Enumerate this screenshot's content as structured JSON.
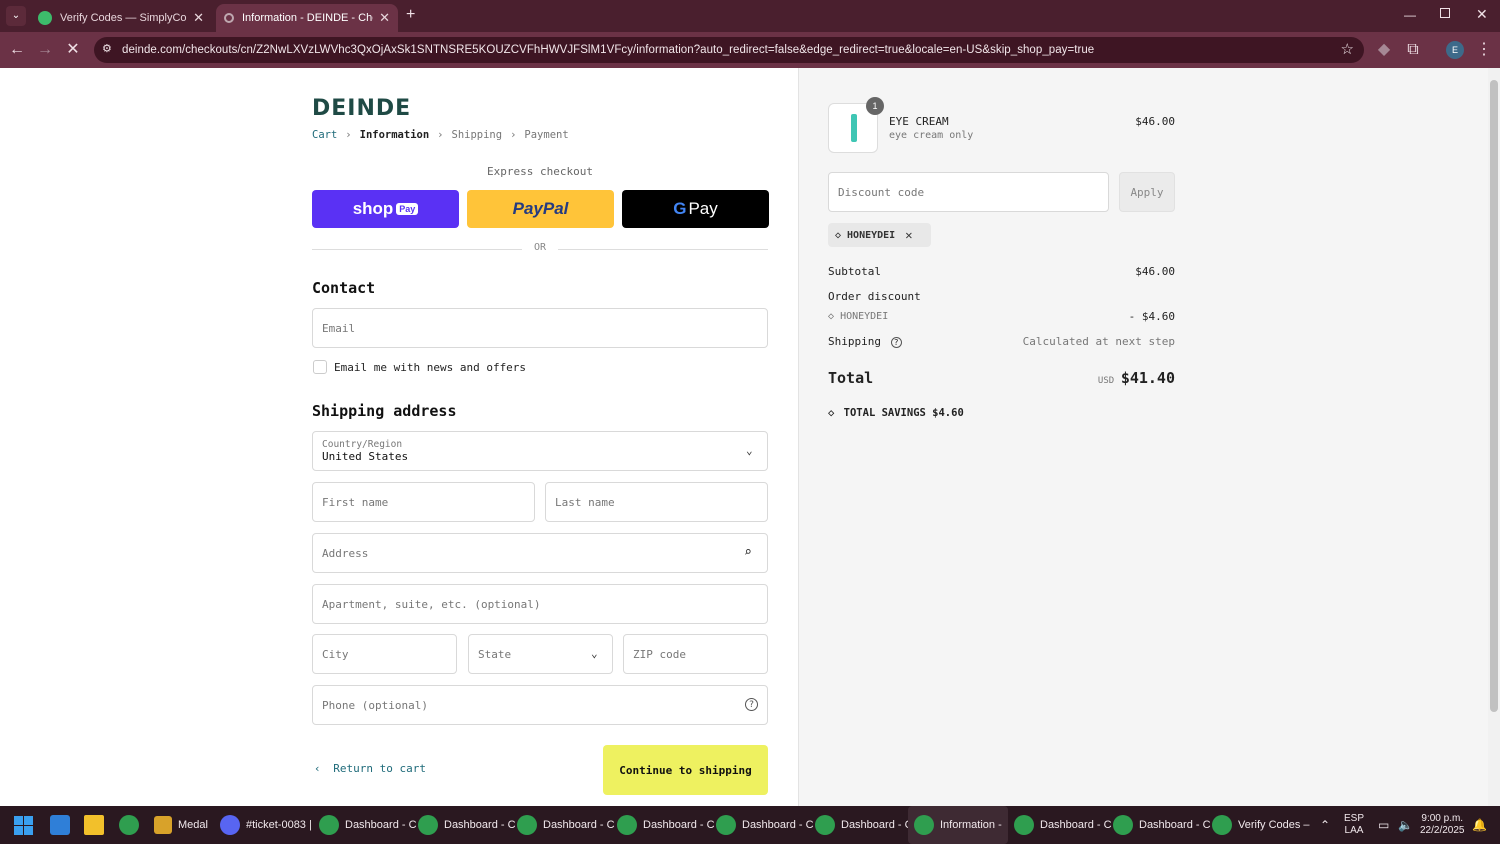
{
  "browser": {
    "tabs": [
      {
        "title": "Verify Codes — SimplyCodes",
        "active": false
      },
      {
        "title": "Information - DEINDE - Checkout",
        "active": true
      }
    ],
    "new_tab": "+",
    "url": "deinde.com/checkouts/cn/Z2NwLXVzLWVhc3QxOjAxSk1SNTNSRE5KOUZCVFhHWVJFSlM1VFcy/information?auto_redirect=false&edge_redirect=true&locale=en-US&skip_shop_pay=true",
    "profile_initial": "E"
  },
  "checkout": {
    "logo": "DEINDE",
    "breadcrumbs": {
      "cart": "Cart",
      "information": "Information",
      "shipping": "Shipping",
      "payment": "Payment"
    },
    "express_label": "Express checkout",
    "shop_pay": "shop",
    "shop_pay_badge": "Pay",
    "paypal": "PayPal",
    "gpay": "Pay",
    "or_label": "OR",
    "contact_heading": "Contact",
    "email_placeholder": "Email",
    "newsletter_label": "Email me with news and offers",
    "shipping_heading": "Shipping address",
    "country_label": "Country/Region",
    "country_value": "United States",
    "first_name": "First name",
    "last_name": "Last name",
    "address": "Address",
    "apartment": "Apartment, suite, etc. (optional)",
    "city": "City",
    "state": "State",
    "zip": "ZIP code",
    "phone": "Phone (optional)",
    "return_label": "Return to cart",
    "continue_label": "Continue to shipping"
  },
  "summary": {
    "item_qty": "1",
    "item_name": "EYE CREAM",
    "item_variant": "eye cream only",
    "item_price": "$46.00",
    "discount_placeholder": "Discount code",
    "apply_label": "Apply",
    "applied_code": "HONEYDEI",
    "subtotal_label": "Subtotal",
    "subtotal_value": "$46.00",
    "order_discount_label": "Order discount",
    "discount_code": "HONEYDEI",
    "discount_value": "- $4.60",
    "shipping_label": "Shipping",
    "shipping_value": "Calculated at next step",
    "total_label": "Total",
    "currency": "USD",
    "total_value": "$41.40",
    "savings_label": "TOTAL SAVINGS $4.60"
  },
  "taskbar": {
    "items": [
      {
        "label": "Medal"
      },
      {
        "label": "#ticket-0083 |"
      },
      {
        "label": "Dashboard - C"
      },
      {
        "label": "Dashboard - C"
      },
      {
        "label": "Dashboard - C"
      },
      {
        "label": "Dashboard - C"
      },
      {
        "label": "Dashboard - C"
      },
      {
        "label": "Dashboard - C"
      },
      {
        "label": "Information -"
      },
      {
        "label": "Dashboard - C"
      },
      {
        "label": "Dashboard - C"
      },
      {
        "label": "Verify Codes –"
      }
    ],
    "lang": "ESP",
    "layout": "LAA",
    "time": "9:00 p.m.",
    "date": "22/2/2025"
  },
  "colors": {
    "accent": "#1f6b7a",
    "continue_bg": "#eef160",
    "shop_pay": "#5a31f4",
    "paypal": "#ffc439"
  }
}
